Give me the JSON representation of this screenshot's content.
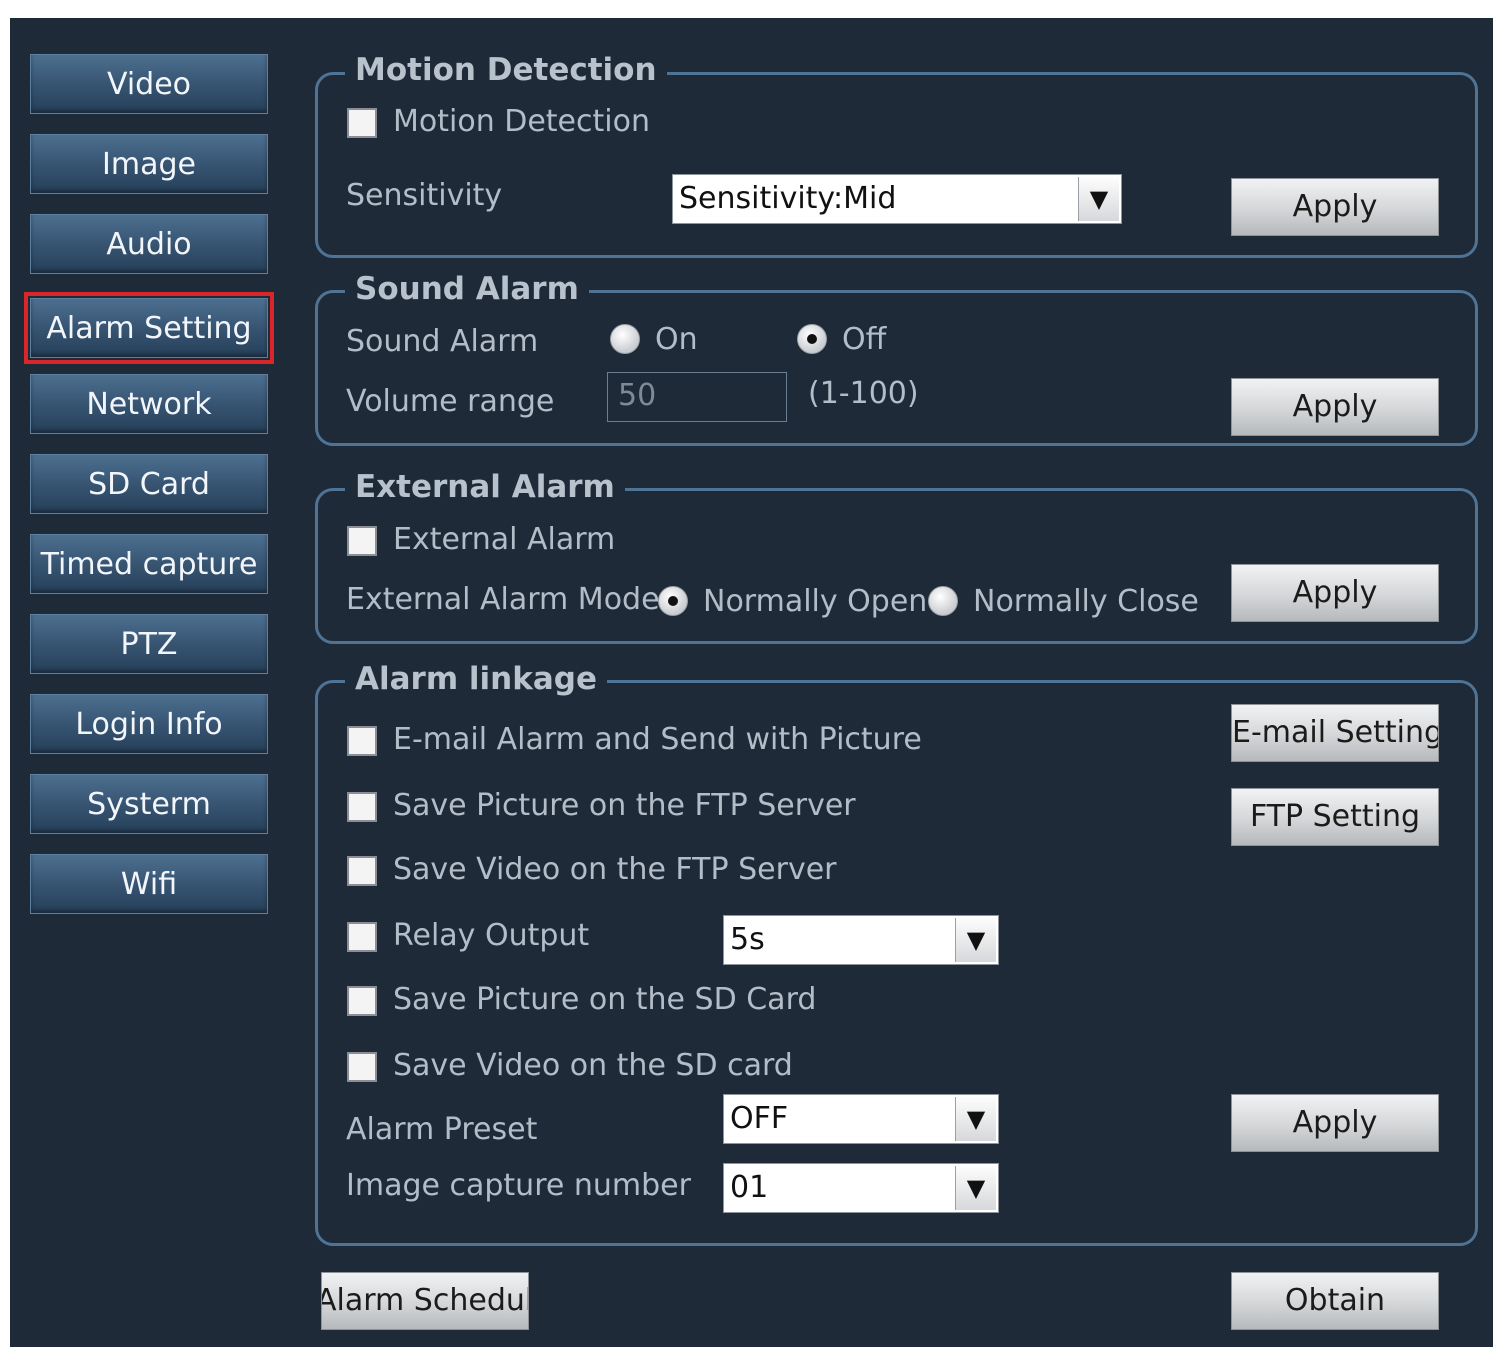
{
  "nav": {
    "items": [
      {
        "label": "Video"
      },
      {
        "label": "Image"
      },
      {
        "label": "Audio"
      },
      {
        "label": "Alarm Setting",
        "active": true
      },
      {
        "label": "Network"
      },
      {
        "label": "SD Card"
      },
      {
        "label": "Timed capture"
      },
      {
        "label": "PTZ"
      },
      {
        "label": "Login Info"
      },
      {
        "label": "Systerm"
      },
      {
        "label": "Wifi"
      }
    ]
  },
  "motion": {
    "title": "Motion Detection",
    "checkbox_label": "Motion Detection",
    "checked": false,
    "sensitivity_label": "Sensitivity",
    "sensitivity_value": "Sensitivity:Mid",
    "apply": "Apply"
  },
  "sound": {
    "title": "Sound Alarm",
    "label": "Sound Alarm",
    "on_label": "On",
    "off_label": "Off",
    "selected": "Off",
    "volume_label": "Volume range",
    "volume_value": "50",
    "volume_hint": "(1-100)",
    "apply": "Apply"
  },
  "external": {
    "title": "External Alarm",
    "checkbox_label": "External Alarm",
    "checked": false,
    "mode_label": "External Alarm Mode",
    "mode_open": "Normally Open",
    "mode_close": "Normally Close",
    "selected": "Normally Open",
    "apply": "Apply"
  },
  "linkage": {
    "title": "Alarm linkage",
    "email_label": "E-mail Alarm and Send with Picture",
    "ftp_picture_label": "Save Picture on the FTP Server",
    "ftp_video_label": "Save Video on the FTP Server",
    "relay_label": "Relay Output",
    "relay_value": "5s",
    "sd_picture_label": "Save Picture on the SD Card",
    "sd_video_label": "Save Video on the SD card",
    "preset_label": "Alarm Preset",
    "preset_value": "OFF",
    "capture_label": "Image capture number",
    "capture_value": "01",
    "email_setting": "E-mail Setting",
    "ftp_setting": "FTP Setting",
    "apply": "Apply"
  },
  "footer": {
    "schedule": "Alarm Schedule",
    "obtain": "Obtain"
  },
  "icons": {
    "dropdown": "chevron-down-icon"
  },
  "colors": {
    "background": "#1e2a38",
    "border": "#4e7394",
    "highlight": "#d9262a"
  }
}
